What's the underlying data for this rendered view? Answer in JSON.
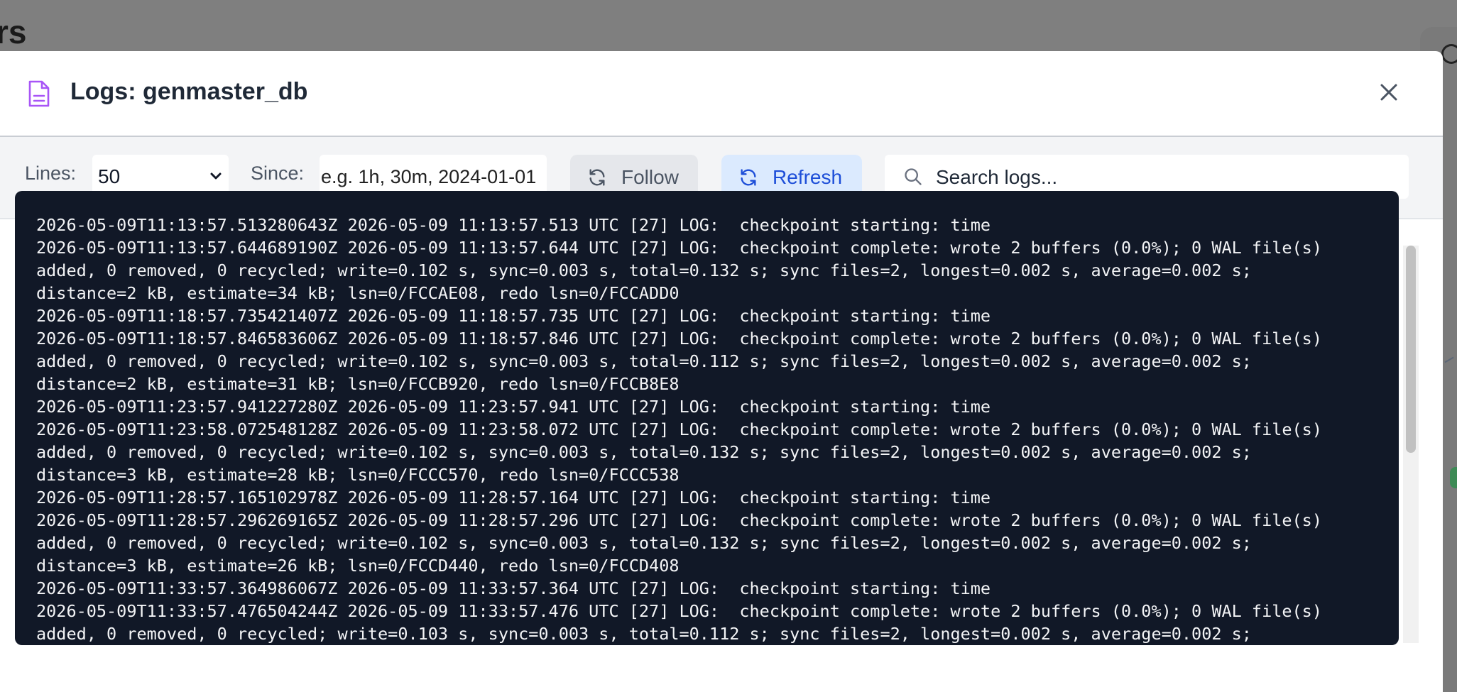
{
  "background": {
    "title_fragment": "rs"
  },
  "modal": {
    "title": "Logs: genmaster_db",
    "title_icon": "file-text-icon",
    "close_icon": "close-icon"
  },
  "toolbar": {
    "lines_label": "Lines:",
    "lines_value": "50",
    "since_label": "Since:",
    "since_placeholder": "e.g. 1h, 30m, 2024-01-01",
    "follow_label": "Follow",
    "refresh_label": "Refresh",
    "search_placeholder": "Search logs..."
  },
  "colors": {
    "accent_purple": "#a855f7",
    "refresh_blue": "#1d4ed8",
    "log_background": "#111827"
  },
  "logs": {
    "lines": [
      "2026-05-09T11:13:57.513280643Z 2026-05-09 11:13:57.513 UTC [27] LOG:  checkpoint starting: time",
      "2026-05-09T11:13:57.644689190Z 2026-05-09 11:13:57.644 UTC [27] LOG:  checkpoint complete: wrote 2 buffers (0.0%); 0 WAL file(s)",
      "added, 0 removed, 0 recycled; write=0.102 s, sync=0.003 s, total=0.132 s; sync files=2, longest=0.002 s, average=0.002 s;",
      "distance=2 kB, estimate=34 kB; lsn=0/FCCAE08, redo lsn=0/FCCADD0",
      "2026-05-09T11:18:57.735421407Z 2026-05-09 11:18:57.735 UTC [27] LOG:  checkpoint starting: time",
      "2026-05-09T11:18:57.846583606Z 2026-05-09 11:18:57.846 UTC [27] LOG:  checkpoint complete: wrote 2 buffers (0.0%); 0 WAL file(s)",
      "added, 0 removed, 0 recycled; write=0.102 s, sync=0.003 s, total=0.112 s; sync files=2, longest=0.002 s, average=0.002 s;",
      "distance=2 kB, estimate=31 kB; lsn=0/FCCB920, redo lsn=0/FCCB8E8",
      "2026-05-09T11:23:57.941227280Z 2026-05-09 11:23:57.941 UTC [27] LOG:  checkpoint starting: time",
      "2026-05-09T11:23:58.072548128Z 2026-05-09 11:23:58.072 UTC [27] LOG:  checkpoint complete: wrote 2 buffers (0.0%); 0 WAL file(s)",
      "added, 0 removed, 0 recycled; write=0.102 s, sync=0.003 s, total=0.132 s; sync files=2, longest=0.002 s, average=0.002 s;",
      "distance=3 kB, estimate=28 kB; lsn=0/FCCC570, redo lsn=0/FCCC538",
      "2026-05-09T11:28:57.165102978Z 2026-05-09 11:28:57.164 UTC [27] LOG:  checkpoint starting: time",
      "2026-05-09T11:28:57.296269165Z 2026-05-09 11:28:57.296 UTC [27] LOG:  checkpoint complete: wrote 2 buffers (0.0%); 0 WAL file(s)",
      "added, 0 removed, 0 recycled; write=0.102 s, sync=0.003 s, total=0.132 s; sync files=2, longest=0.002 s, average=0.002 s;",
      "distance=3 kB, estimate=26 kB; lsn=0/FCCD440, redo lsn=0/FCCD408",
      "2026-05-09T11:33:57.364986067Z 2026-05-09 11:33:57.364 UTC [27] LOG:  checkpoint starting: time",
      "2026-05-09T11:33:57.476504244Z 2026-05-09 11:33:57.476 UTC [27] LOG:  checkpoint complete: wrote 2 buffers (0.0%); 0 WAL file(s)",
      "added, 0 removed, 0 recycled; write=0.103 s, sync=0.003 s, total=0.112 s; sync files=2, longest=0.002 s, average=0.002 s;"
    ]
  }
}
